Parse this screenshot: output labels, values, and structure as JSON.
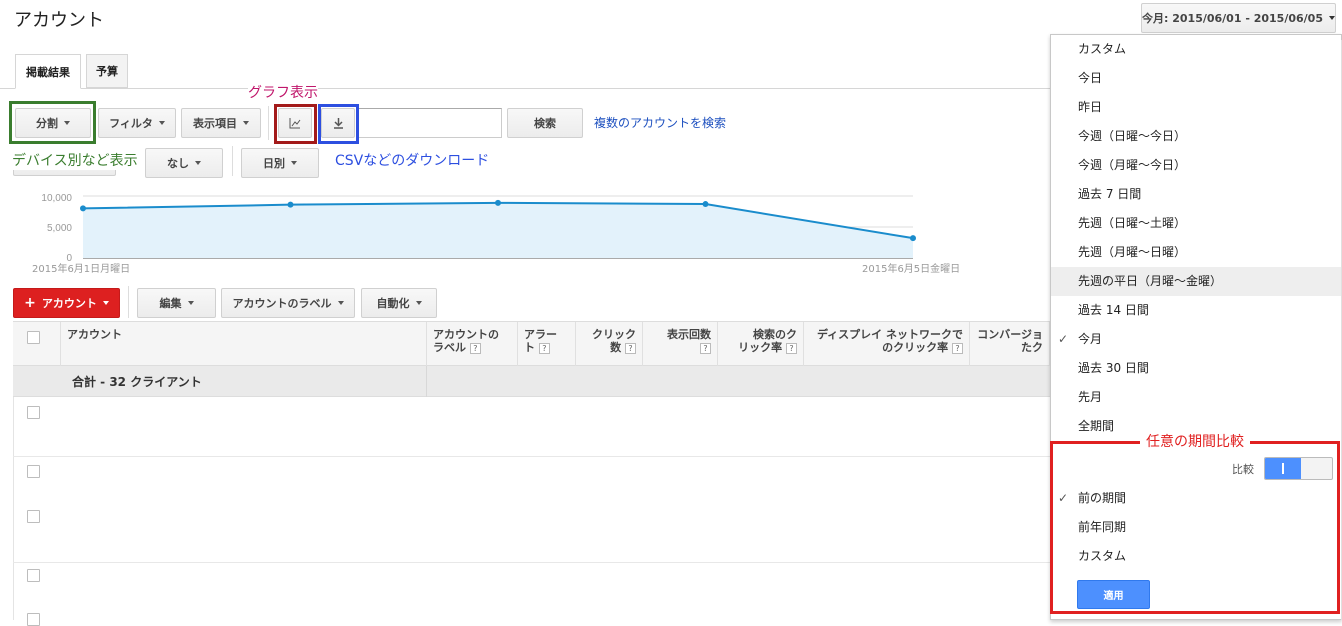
{
  "page": {
    "title": "アカウント"
  },
  "tabs": [
    {
      "label": "掲載結果"
    },
    {
      "label": "予算"
    }
  ],
  "toolbar": {
    "segment": "分割",
    "filter": "フィルタ",
    "columns": "表示項目",
    "search_button": "検索",
    "search_value": "",
    "multi_account_link": "複数のアカウントを検索",
    "none": "なし",
    "daily": "日別"
  },
  "annotations": {
    "graph": "グラフ表示",
    "device": "デバイス別など表示",
    "csv": "CSVなどのダウンロード",
    "compare": "任意の期間比較"
  },
  "chart_data": {
    "type": "area",
    "x": [
      "2015-06-01",
      "2015-06-02",
      "2015-06-03",
      "2015-06-04",
      "2015-06-05"
    ],
    "series": [
      {
        "values": [
          8000,
          8600,
          8900,
          8700,
          3200
        ]
      }
    ],
    "ylim": [
      0,
      10000
    ],
    "yticks": [
      "10,000",
      "5,000",
      "0"
    ],
    "x_start_label": "2015年6月1日月曜日",
    "x_end_label": "2015年6月5日金曜日",
    "color": "#1a8ccc",
    "fill": "#e3f2fb",
    "grid": true
  },
  "actions": {
    "add_account": "アカウント",
    "edit": "編集",
    "account_label": "アカウントのラベル",
    "automate": "自動化"
  },
  "table": {
    "headers": {
      "account": "アカウント",
      "label_a": "アカウントの",
      "label_b": "ラベル",
      "alert_a": "アラー",
      "alert_b": "ト",
      "clicks_a": "クリック",
      "clicks_b": "数",
      "impr": "表示回数",
      "sctr_a": "検索のク",
      "sctr_b": "リック率",
      "dctr_a": "ディスプレイ ネットワークで",
      "dctr_b": "のクリック率",
      "conv_a": "コンバージョ",
      "conv_b": "たク"
    },
    "total": "合計 - 32 クライアント"
  },
  "date_range": {
    "label": "今月: 2015/06/01 - 2015/06/05",
    "options": [
      "カスタム",
      "今日",
      "昨日",
      "今週（日曜〜今日）",
      "今週（月曜〜今日）",
      "過去 7 日間",
      "先週（日曜〜土曜）",
      "先週（月曜〜日曜）",
      "先週の平日（月曜〜金曜）",
      "過去 14 日間",
      "今月",
      "過去 30 日間",
      "先月",
      "全期間"
    ],
    "selected": "今月",
    "hovered": "先週の平日（月曜〜金曜）",
    "compare_label": "比較",
    "compare_options": [
      "前の期間",
      "前年同期",
      "カスタム"
    ],
    "compare_selected": "前の期間",
    "apply": "適用"
  },
  "colors": {
    "green": "#3a7d2e",
    "darkred": "#a31a1a",
    "blue": "#2d4fe0",
    "red": "#e02020",
    "accent": "#4d90fe"
  }
}
